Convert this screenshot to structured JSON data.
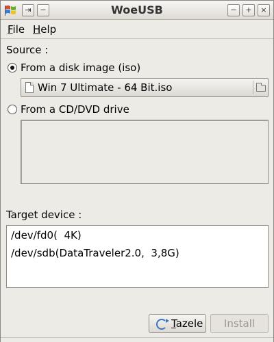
{
  "window": {
    "title": "WoeUSB",
    "controls": {
      "pin": "⇥",
      "shade": "−",
      "minimize": "−",
      "maximize": "+",
      "close": "×"
    }
  },
  "menu": {
    "file": {
      "accel": "F",
      "rest": "ile"
    },
    "help": {
      "accel": "H",
      "rest": "elp"
    }
  },
  "source": {
    "heading": "Source :",
    "disk_image_option": "From a disk image (iso)",
    "disk_image_selected": true,
    "file_name": "Win 7 Ultimate - 64 Bit.iso",
    "cd_option": "From a CD/DVD drive",
    "cd_selected": false
  },
  "target": {
    "heading": "Target device :",
    "devices": [
      "/dev/fd0(  4K)",
      "/dev/sdb(DataTraveler2.0,  3,8G)"
    ]
  },
  "actions": {
    "refresh": {
      "accel": "T",
      "rest": "azele"
    },
    "install": "Install",
    "install_enabled": false
  },
  "icons": {
    "app": "windows-flag-icon",
    "file": "document-icon",
    "browse": "folder-icon",
    "refresh": "refresh-icon"
  }
}
